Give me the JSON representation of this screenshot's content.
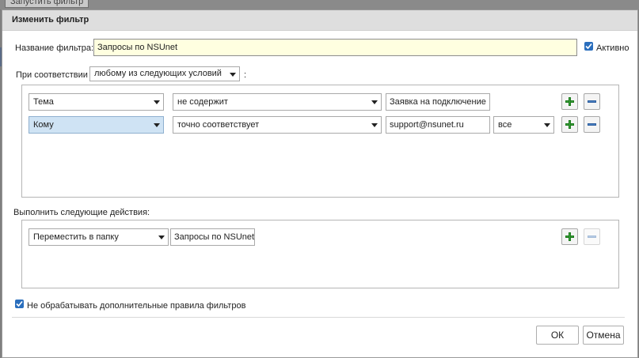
{
  "background": {
    "tab_label": "Запустить фильтр"
  },
  "dialog": {
    "title": "Изменить фильтр",
    "filter_name_label": "Название фильтра:",
    "filter_name_value": "Запросы по NSUnet",
    "active_label": "Активно",
    "active_checked": true,
    "match_label": "При соответствии",
    "match_value": "любому из следующих условий",
    "match_suffix": ":",
    "conditions": [
      {
        "field": "Тема",
        "operator": "не содержит",
        "value": "Заявка на подключение",
        "extra": ""
      },
      {
        "field": "Кому",
        "operator": "точно соответствует",
        "value": "support@nsunet.ru",
        "extra": "все"
      }
    ],
    "actions_label": "Выполнить следующие действия:",
    "actions": [
      {
        "action": "Переместить в папку",
        "target": "Запросы по NSUnet"
      }
    ],
    "stop_rules_label": "Не обрабатывать дополнительные правила фильтров",
    "stop_rules_checked": true,
    "ok_label": "ОК",
    "cancel_label": "Отмена"
  },
  "colors": {
    "accent": "#2a6ebd",
    "plus_green": "#3aa23a",
    "minus_blue": "#4a80c2",
    "highlight_yellow": "#ffffe0",
    "selected_select": "#cfe3f4"
  },
  "icons": {
    "add": "plus-icon",
    "remove": "minus-icon",
    "dropdown": "chevron-down-icon",
    "check": "checkmark-icon"
  }
}
